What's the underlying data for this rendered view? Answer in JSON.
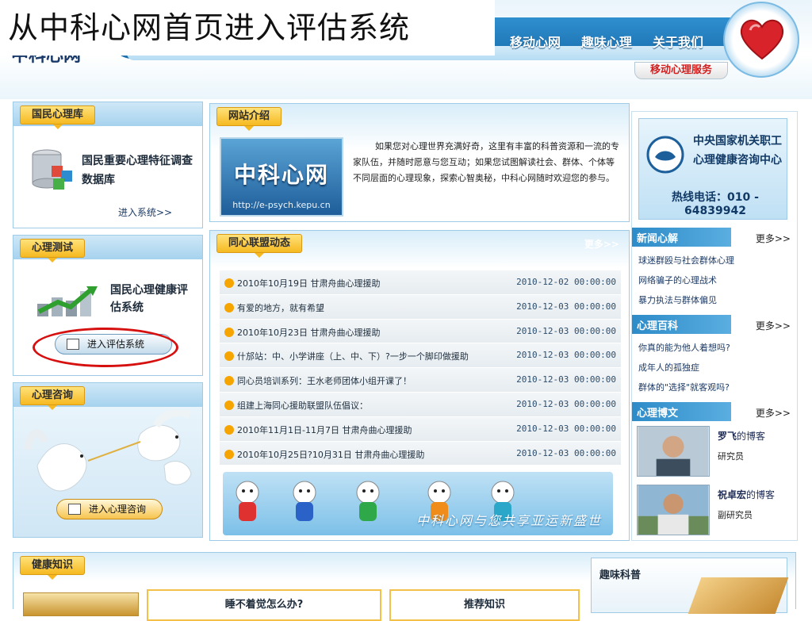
{
  "slide_title": "从中科心网首页进入评估系统",
  "site_logo": "中科心网",
  "nav": {
    "items": [
      "移动心网",
      "趣味心理",
      "关于我们"
    ],
    "mobile_service": "移动心理服务"
  },
  "panels": {
    "db": {
      "tab": "国民心理库",
      "title": "国民重要心理特征调查数据库",
      "enter": "进入系统>>"
    },
    "test": {
      "tab": "心理测试",
      "title": "国民心理健康评估系统",
      "enter": "进入评估系统"
    },
    "consult": {
      "tab": "心理咨询",
      "enter": "进入心理咨询"
    },
    "intro": {
      "tab": "网站介绍",
      "banner_title": "中科心网",
      "banner_url": "http://e-psych.kepu.cn",
      "text": "如果您对心理世界充满好奇，这里有丰富的科普资源和一流的专家队伍，并随时愿意与您互动；如果您试图解读社会、群体、个体等不同层面的心理现象，探索心智奥秘，中科心网随时欢迎您的参与。"
    },
    "news": {
      "tab": "同心联盟动态",
      "more": "更多>>",
      "items": [
        {
          "title": "2010年10月19日 甘肃舟曲心理援助",
          "date": "2010-12-02 00:00:00"
        },
        {
          "title": "有爱的地方，就有希望",
          "date": "2010-12-03 00:00:00"
        },
        {
          "title": "2010年10月23日 甘肃舟曲心理援助",
          "date": "2010-12-03 00:00:00"
        },
        {
          "title": "什邡站：中、小学讲座（上、中、下）?一步一个脚印做援助",
          "date": "2010-12-03 00:00:00"
        },
        {
          "title": "同心员培训系列：王水老师团体小组开课了！",
          "date": "2010-12-03 00:00:00"
        },
        {
          "title": "组建上海同心援助联盟队伍倡议：",
          "date": "2010-12-03 00:00:00"
        },
        {
          "title": "2010年11月1日-11月7日 甘肃舟曲心理援助",
          "date": "2010-12-03 00:00:00"
        },
        {
          "title": "2010年10月25日?10月31日 甘肃舟曲心理援助",
          "date": "2010-12-03 00:00:00"
        }
      ],
      "slogan": "中科心网与您共享亚运新盛世"
    }
  },
  "right": {
    "ad": {
      "name": "中央国家机关职工心理健康咨询中心",
      "phone": "热线电话：010 - 64839942"
    },
    "news_section": {
      "title": "新闻心解",
      "more": "更多>>",
      "items": [
        "球迷群殴与社会群体心理",
        "网络骗子的心理战术",
        "暴力执法与群体偏见"
      ]
    },
    "wiki_section": {
      "title": "心理百科",
      "more": "更多>>",
      "items": [
        "你真的能为他人着想吗?",
        "成年人的孤独症",
        "群体的\"选择\"就客观吗?"
      ]
    },
    "blog_section": {
      "title": "心理博文",
      "more": "更多>>",
      "bloggers": [
        {
          "name": "罗飞",
          "suffix": "的博客",
          "role": "研究员"
        },
        {
          "name": "祝卓宏",
          "suffix": "的博客",
          "role": "副研究员"
        }
      ]
    }
  },
  "bottom": {
    "tab": "健康知识",
    "card1": "睡不着觉怎么办?",
    "card2": "推荐知识",
    "fun_science": "趣味科普"
  },
  "colors": {
    "brand_blue": "#1b6fae",
    "tab_gold": "#f6b921",
    "highlight_red": "#d60f0f"
  }
}
